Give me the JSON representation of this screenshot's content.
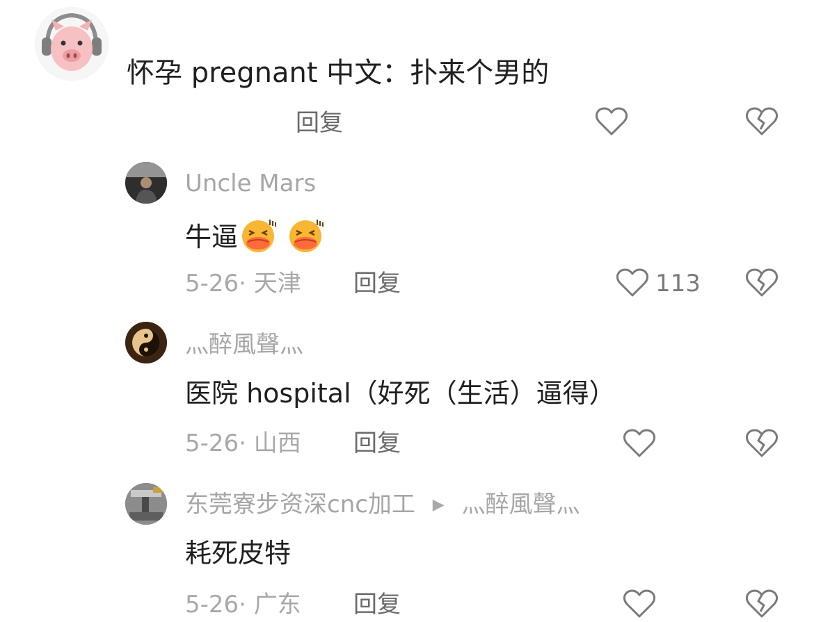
{
  "comments": [
    {
      "avatar": "pig-avatar",
      "content": "怀孕 pregnant   中文：扑来个男的",
      "reply_label": "回复"
    }
  ],
  "replies": [
    {
      "username": "Uncle Mars",
      "content": "牛逼",
      "emoji": [
        "laughing-emoji",
        "laughing-emoji"
      ],
      "date": "5-26",
      "location": "· 天津",
      "reply_label": "回复",
      "likes": "113"
    },
    {
      "username": "灬醉風聲灬",
      "content": "医院   hospital（好死（生活）逼得）",
      "date": "5-26",
      "location": "· 山西",
      "reply_label": "回复"
    },
    {
      "username": "东莞寮步资深cnc加工",
      "reply_to": "灬醉風聲灬",
      "content": "耗死皮特",
      "date": "5-26",
      "location": "· 广东",
      "reply_label": "回复"
    }
  ],
  "icons": {
    "like": "heart-outline-icon",
    "dislike": "broken-heart-icon",
    "reply_arrow": "triangle-right-icon"
  },
  "colors": {
    "text": "#1f1f1f",
    "muted": "#a8a8a8",
    "action": "#6a6a6a"
  }
}
